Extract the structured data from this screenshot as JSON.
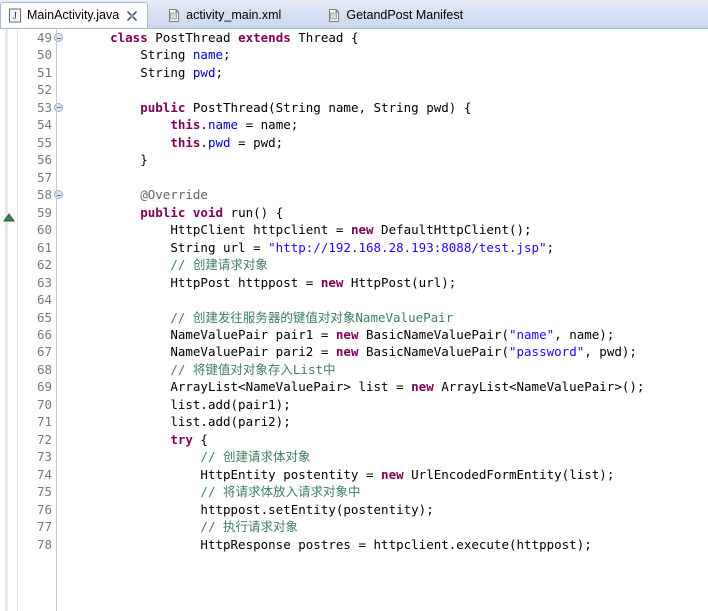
{
  "tabs": [
    {
      "label": "MainActivity.java",
      "icon": "java-file-icon",
      "active": true,
      "closable": true
    },
    {
      "label": "activity_main.xml",
      "icon": "xml-file-icon",
      "active": false,
      "closable": false
    },
    {
      "label": "GetandPost Manifest",
      "icon": "xml-file-icon",
      "active": false,
      "closable": false
    }
  ],
  "editor": {
    "first_line": 49,
    "last_line": 78,
    "fold_lines": [
      49,
      53,
      58
    ],
    "override_marker_line": 59,
    "colors": {
      "keyword": "#7f0055",
      "field": "#0000c0",
      "string": "#2a00ff",
      "comment": "#3f7f5f",
      "annotation": "#646464",
      "background": "#ffffff",
      "gutter_text": "#7a7a7a"
    },
    "lines": [
      {
        "n": 49,
        "indent": 4,
        "tokens": [
          {
            "t": "class",
            "c": "kw"
          },
          {
            "t": " PostThread ",
            "c": "plain"
          },
          {
            "t": "extends",
            "c": "kw"
          },
          {
            "t": " Thread {",
            "c": "plain"
          }
        ]
      },
      {
        "n": 50,
        "indent": 8,
        "tokens": [
          {
            "t": "String ",
            "c": "plain"
          },
          {
            "t": "name",
            "c": "fld"
          },
          {
            "t": ";",
            "c": "plain"
          }
        ]
      },
      {
        "n": 51,
        "indent": 8,
        "tokens": [
          {
            "t": "String ",
            "c": "plain"
          },
          {
            "t": "pwd",
            "c": "fld"
          },
          {
            "t": ";",
            "c": "plain"
          }
        ]
      },
      {
        "n": 52,
        "indent": 0,
        "tokens": []
      },
      {
        "n": 53,
        "indent": 8,
        "tokens": [
          {
            "t": "public",
            "c": "kw"
          },
          {
            "t": " PostThread(String name, String pwd) {",
            "c": "plain"
          }
        ]
      },
      {
        "n": 54,
        "indent": 12,
        "tokens": [
          {
            "t": "this",
            "c": "kw"
          },
          {
            "t": ".",
            "c": "plain"
          },
          {
            "t": "name",
            "c": "fld"
          },
          {
            "t": " = name;",
            "c": "plain"
          }
        ]
      },
      {
        "n": 55,
        "indent": 12,
        "tokens": [
          {
            "t": "this",
            "c": "kw"
          },
          {
            "t": ".",
            "c": "plain"
          },
          {
            "t": "pwd",
            "c": "fld"
          },
          {
            "t": " = pwd;",
            "c": "plain"
          }
        ]
      },
      {
        "n": 56,
        "indent": 8,
        "tokens": [
          {
            "t": "}",
            "c": "plain"
          }
        ]
      },
      {
        "n": 57,
        "indent": 0,
        "tokens": []
      },
      {
        "n": 58,
        "indent": 8,
        "tokens": [
          {
            "t": "@Override",
            "c": "ann"
          }
        ]
      },
      {
        "n": 59,
        "indent": 8,
        "tokens": [
          {
            "t": "public",
            "c": "kw"
          },
          {
            "t": " ",
            "c": "plain"
          },
          {
            "t": "void",
            "c": "kw"
          },
          {
            "t": " run() {",
            "c": "plain"
          }
        ]
      },
      {
        "n": 60,
        "indent": 12,
        "tokens": [
          {
            "t": "HttpClient httpclient = ",
            "c": "plain"
          },
          {
            "t": "new",
            "c": "kw"
          },
          {
            "t": " DefaultHttpClient();",
            "c": "plain"
          }
        ]
      },
      {
        "n": 61,
        "indent": 12,
        "tokens": [
          {
            "t": "String url = ",
            "c": "plain"
          },
          {
            "t": "\"http://192.168.28.193:8088/test.jsp\"",
            "c": "str"
          },
          {
            "t": ";",
            "c": "plain"
          }
        ]
      },
      {
        "n": 62,
        "indent": 12,
        "tokens": [
          {
            "t": "// 创建请求对象",
            "c": "cmt"
          }
        ]
      },
      {
        "n": 63,
        "indent": 12,
        "tokens": [
          {
            "t": "HttpPost httppost = ",
            "c": "plain"
          },
          {
            "t": "new",
            "c": "kw"
          },
          {
            "t": " HttpPost(url);",
            "c": "plain"
          }
        ]
      },
      {
        "n": 64,
        "indent": 0,
        "tokens": []
      },
      {
        "n": 65,
        "indent": 12,
        "tokens": [
          {
            "t": "// 创建发往服务器的键值对对象NameValuePair",
            "c": "cmt"
          }
        ]
      },
      {
        "n": 66,
        "indent": 12,
        "tokens": [
          {
            "t": "NameValuePair pair1 = ",
            "c": "plain"
          },
          {
            "t": "new",
            "c": "kw"
          },
          {
            "t": " BasicNameValuePair(",
            "c": "plain"
          },
          {
            "t": "\"name\"",
            "c": "str"
          },
          {
            "t": ", name);",
            "c": "plain"
          }
        ]
      },
      {
        "n": 67,
        "indent": 12,
        "tokens": [
          {
            "t": "NameValuePair pari2 = ",
            "c": "plain"
          },
          {
            "t": "new",
            "c": "kw"
          },
          {
            "t": " BasicNameValuePair(",
            "c": "plain"
          },
          {
            "t": "\"password\"",
            "c": "str"
          },
          {
            "t": ", pwd);",
            "c": "plain"
          }
        ]
      },
      {
        "n": 68,
        "indent": 12,
        "tokens": [
          {
            "t": "// 将键值对对象存入List中",
            "c": "cmt"
          }
        ]
      },
      {
        "n": 69,
        "indent": 12,
        "tokens": [
          {
            "t": "ArrayList<NameValuePair> list = ",
            "c": "plain"
          },
          {
            "t": "new",
            "c": "kw"
          },
          {
            "t": " ArrayList<NameValuePair>();",
            "c": "plain"
          }
        ]
      },
      {
        "n": 70,
        "indent": 12,
        "tokens": [
          {
            "t": "list.add(pair1);",
            "c": "plain"
          }
        ]
      },
      {
        "n": 71,
        "indent": 12,
        "tokens": [
          {
            "t": "list.add(pari2);",
            "c": "plain"
          }
        ]
      },
      {
        "n": 72,
        "indent": 12,
        "tokens": [
          {
            "t": "try",
            "c": "kw"
          },
          {
            "t": " {",
            "c": "plain"
          }
        ]
      },
      {
        "n": 73,
        "indent": 16,
        "tokens": [
          {
            "t": "// 创建请求体对象",
            "c": "cmt"
          }
        ]
      },
      {
        "n": 74,
        "indent": 16,
        "tokens": [
          {
            "t": "HttpEntity postentity = ",
            "c": "plain"
          },
          {
            "t": "new",
            "c": "kw"
          },
          {
            "t": " UrlEncodedFormEntity(list);",
            "c": "plain"
          }
        ]
      },
      {
        "n": 75,
        "indent": 16,
        "tokens": [
          {
            "t": "// 将请求体放入请求对象中",
            "c": "cmt"
          }
        ]
      },
      {
        "n": 76,
        "indent": 16,
        "tokens": [
          {
            "t": "httppost.setEntity(postentity);",
            "c": "plain"
          }
        ]
      },
      {
        "n": 77,
        "indent": 16,
        "tokens": [
          {
            "t": "// 执行请求对象",
            "c": "cmt"
          }
        ]
      },
      {
        "n": 78,
        "indent": 16,
        "tokens": [
          {
            "t": "HttpResponse postres = httpclient.execute(httppost);",
            "c": "plain"
          }
        ]
      }
    ]
  }
}
